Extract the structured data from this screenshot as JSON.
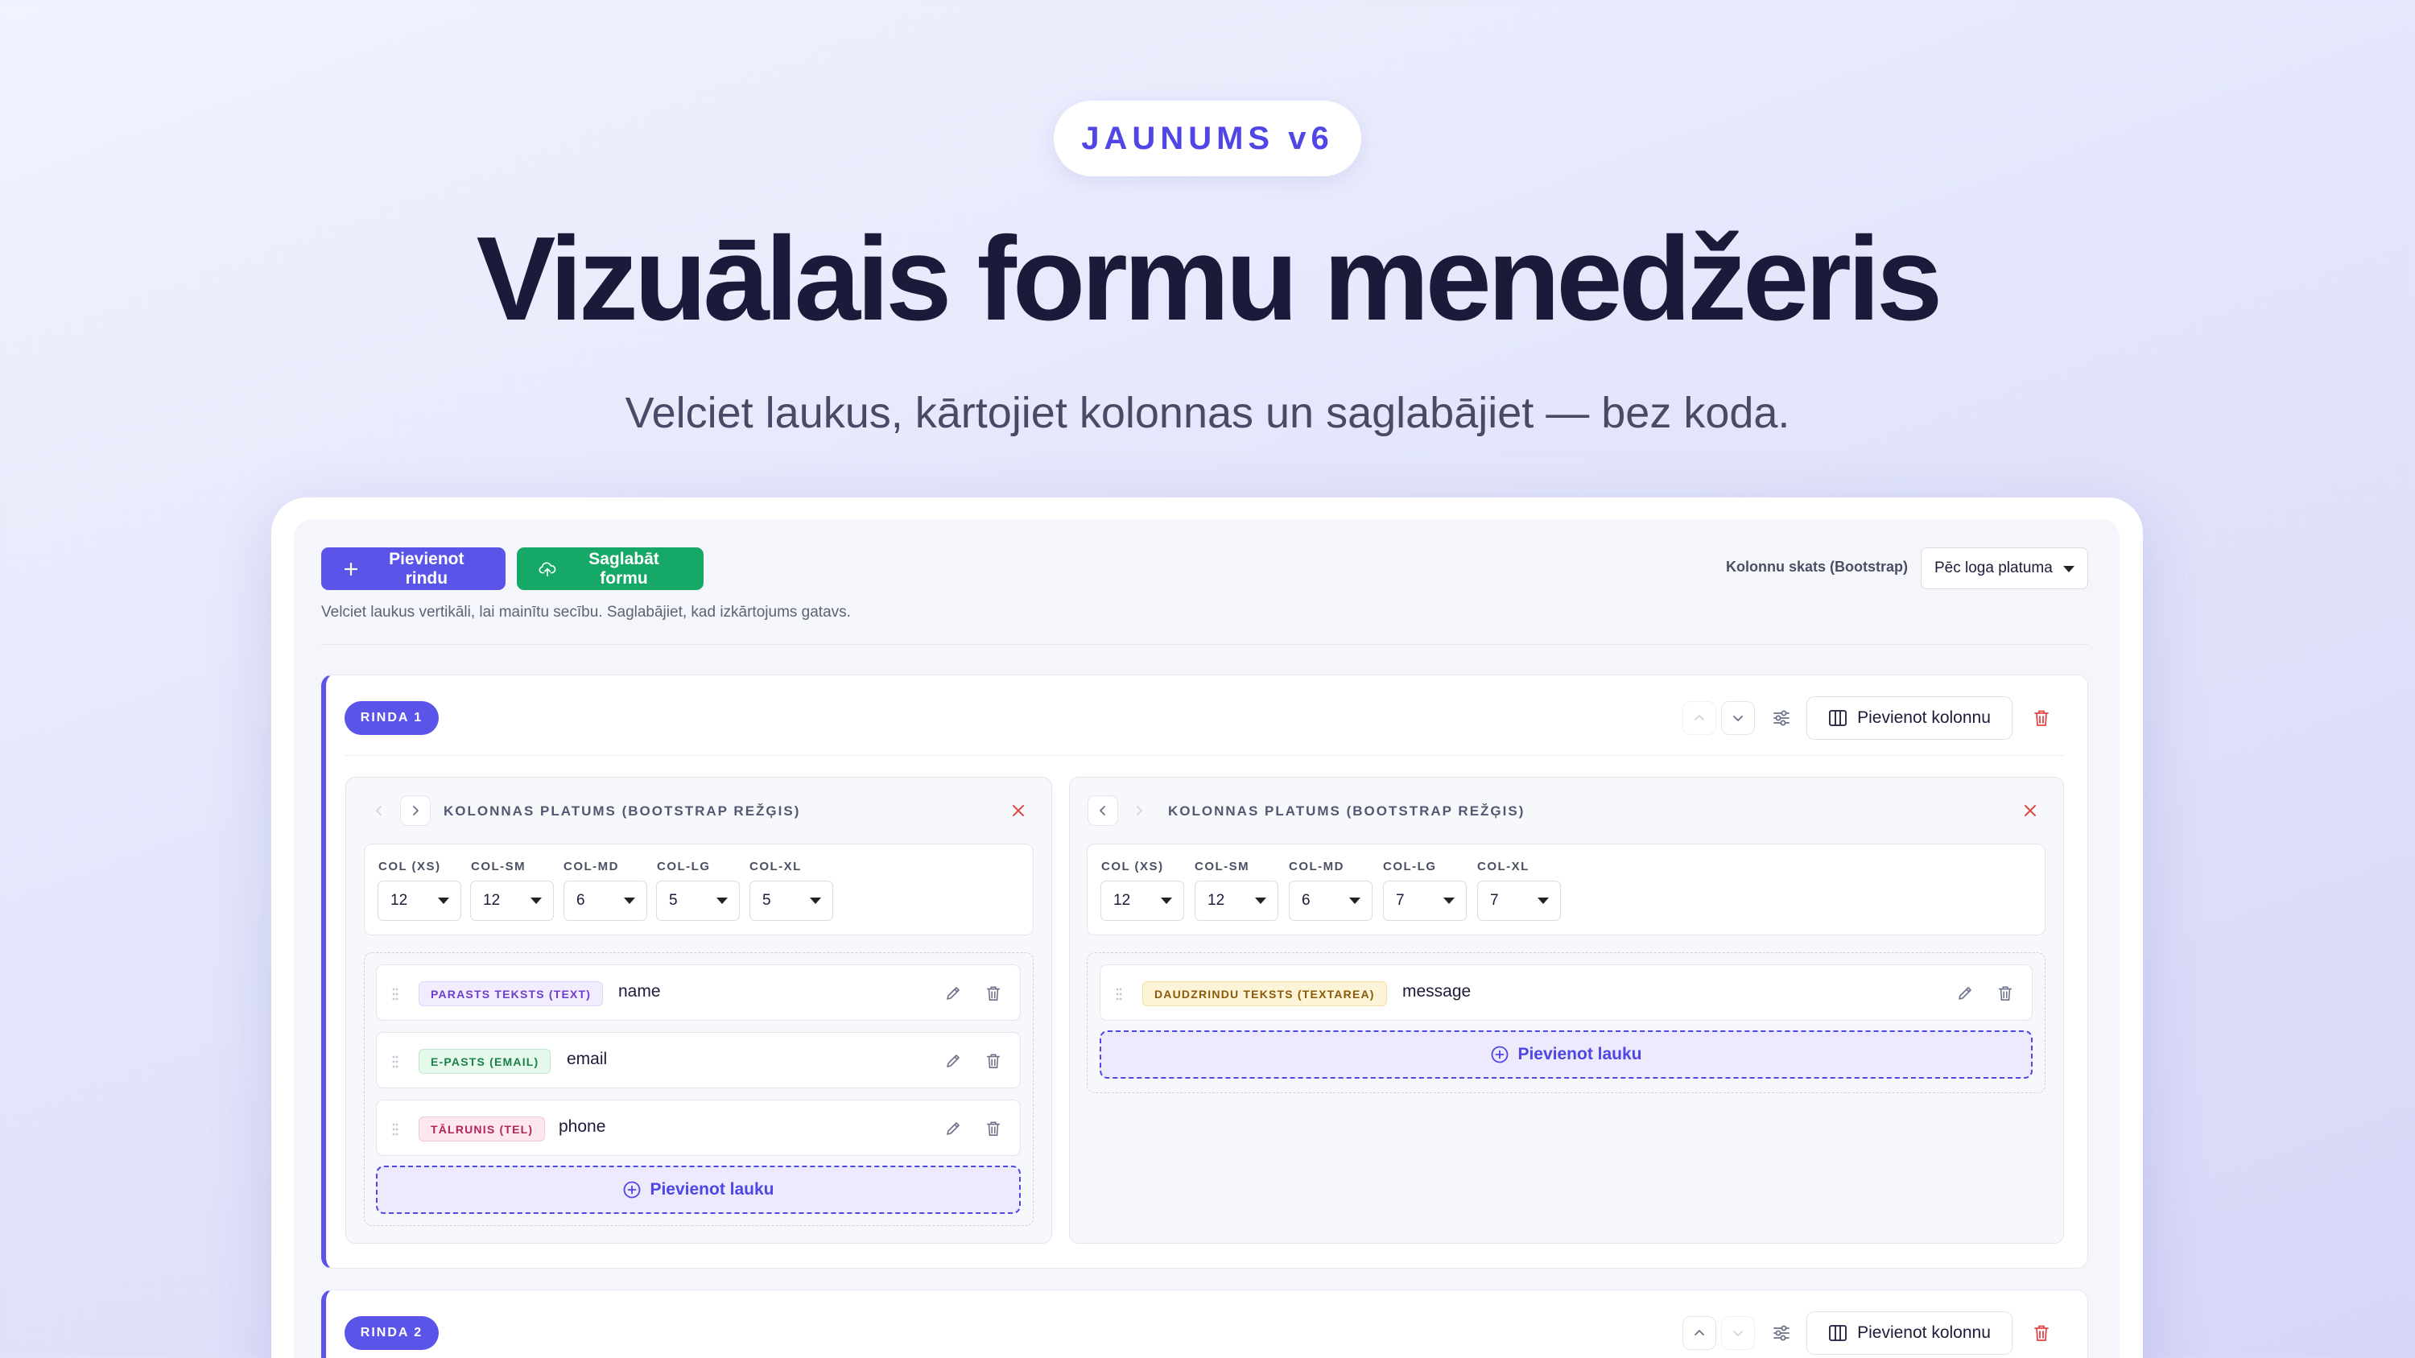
{
  "hero": {
    "badge": "JAUNUMS v6",
    "title": "Vizuālais formu menedžeris",
    "subtitle": "Velciet laukus, kārtojiet kolonnas un saglabājiet — bez koda."
  },
  "toolbar": {
    "add_row_label": "Pievienot rindu",
    "save_form_label": "Saglabāt formu",
    "hint": "Velciet laukus vertikāli, lai mainītu secību. Saglabājiet, kad izkārtojums gatavs.",
    "view_label": "Kolonnu skats (Bootstrap)",
    "view_value": "Pēc loga platuma"
  },
  "colors": {
    "accent": "#5b54e8",
    "success": "#16a866",
    "danger": "#e04646"
  },
  "rows": [
    {
      "label": "RINDA 1",
      "add_column_label": "Pievienot kolonnu",
      "columns": [
        {
          "heading": "KOLONNAS PLATUMS (BOOTSTRAP REŽĢIS)",
          "breakpoints": [
            {
              "label": "COL (XS)",
              "value": "12"
            },
            {
              "label": "COL-SM",
              "value": "12"
            },
            {
              "label": "COL-MD",
              "value": "6"
            },
            {
              "label": "COL-LG",
              "value": "5"
            },
            {
              "label": "COL-XL",
              "value": "5"
            }
          ],
          "fields": [
            {
              "type": "PARASTS TEKSTS (TEXT)",
              "name": "name"
            },
            {
              "type": "E-PASTS (EMAIL)",
              "name": "email"
            },
            {
              "type": "TĀLRUNIS (TEL)",
              "name": "phone"
            }
          ],
          "add_field_label": "Pievienot lauku"
        },
        {
          "heading": "KOLONNAS PLATUMS (BOOTSTRAP REŽĢIS)",
          "breakpoints": [
            {
              "label": "COL (XS)",
              "value": "12"
            },
            {
              "label": "COL-SM",
              "value": "12"
            },
            {
              "label": "COL-MD",
              "value": "6"
            },
            {
              "label": "COL-LG",
              "value": "7"
            },
            {
              "label": "COL-XL",
              "value": "7"
            }
          ],
          "fields": [
            {
              "type": "DAUDZRINDU TEKSTS (TEXTAREA)",
              "name": "message"
            }
          ],
          "add_field_label": "Pievienot lauku"
        }
      ]
    },
    {
      "label": "RINDA 2",
      "add_column_label": "Pievienot kolonnu"
    }
  ]
}
